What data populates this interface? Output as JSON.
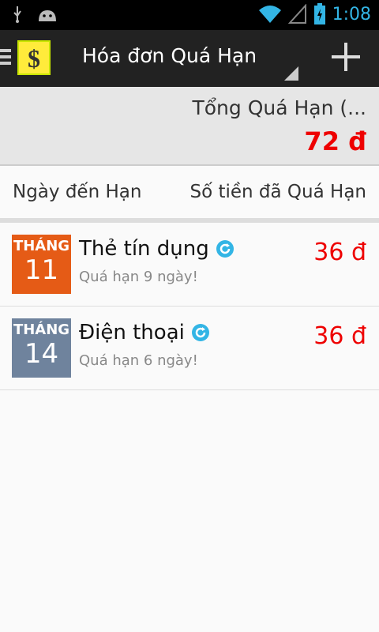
{
  "status": {
    "time": "1:08"
  },
  "app": {
    "title": "Hóa đơn Quá Hạn"
  },
  "summary": {
    "label": "Tổng Quá Hạn (...",
    "value": "72 đ"
  },
  "columns": {
    "left": "Ngày đến Hạn",
    "right": "Số tiền đã Quá Hạn"
  },
  "items": [
    {
      "month_label": "THÁNG",
      "day": "11",
      "title": "Thẻ tín dụng",
      "subtitle": "Quá hạn 9 ngày!",
      "amount": "36 đ",
      "color": "#e55b16"
    },
    {
      "month_label": "THÁNG",
      "day": "14",
      "title": "Điện thoại",
      "subtitle": "Quá hạn 6 ngày!",
      "amount": "36 đ",
      "color": "#6f839d"
    }
  ],
  "colors": {
    "accent": "#33b5e5",
    "overdue": "#e00000"
  },
  "icons": {
    "sync": "sync-icon",
    "add": "plus-icon",
    "logo": "dollar-logo"
  }
}
